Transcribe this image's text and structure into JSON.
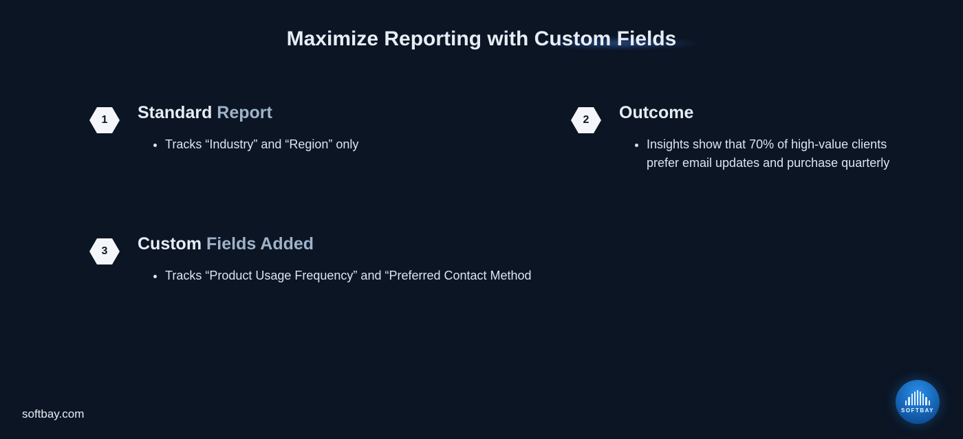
{
  "title": "Maximize Reporting with Custom Fields",
  "sections": [
    {
      "num": "1",
      "title_a": "Standard ",
      "title_b": "Report",
      "bullet": "Tracks “Industry” and “Region” only"
    },
    {
      "num": "2",
      "title_a": "Outcome",
      "title_b": "",
      "bullet": "Insights show that 70% of high-value clients prefer email updates and purchase quarterly"
    },
    {
      "num": "3",
      "title_a": "Custom ",
      "title_b": "Fields Added",
      "bullet": "Tracks “Product Usage Frequency” and “Preferred Contact Method"
    }
  ],
  "footer_url": "softbay.com",
  "logo_text": "SOFTBAY"
}
